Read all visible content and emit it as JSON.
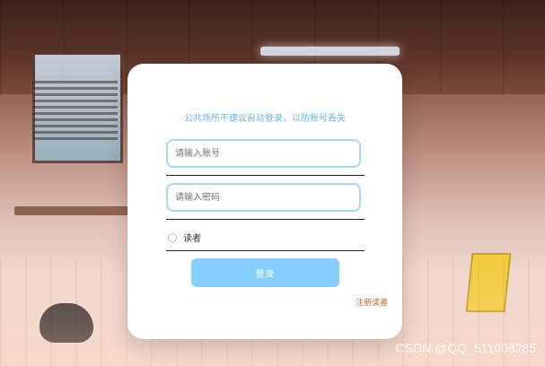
{
  "hint": "公共场所不建议自动登录，以防账号丢失",
  "form": {
    "account_placeholder": "请输入账号",
    "password_placeholder": "请输入密码",
    "role_label": "读者",
    "login_label": "登录",
    "register_link": "注册读者"
  },
  "watermark": "CSDN @QQ_511008285",
  "colors": {
    "accent": "#84cfff",
    "hint": "#6bb8e6",
    "field_border": "#a7d8f3",
    "register_link": "#b36a2d"
  }
}
